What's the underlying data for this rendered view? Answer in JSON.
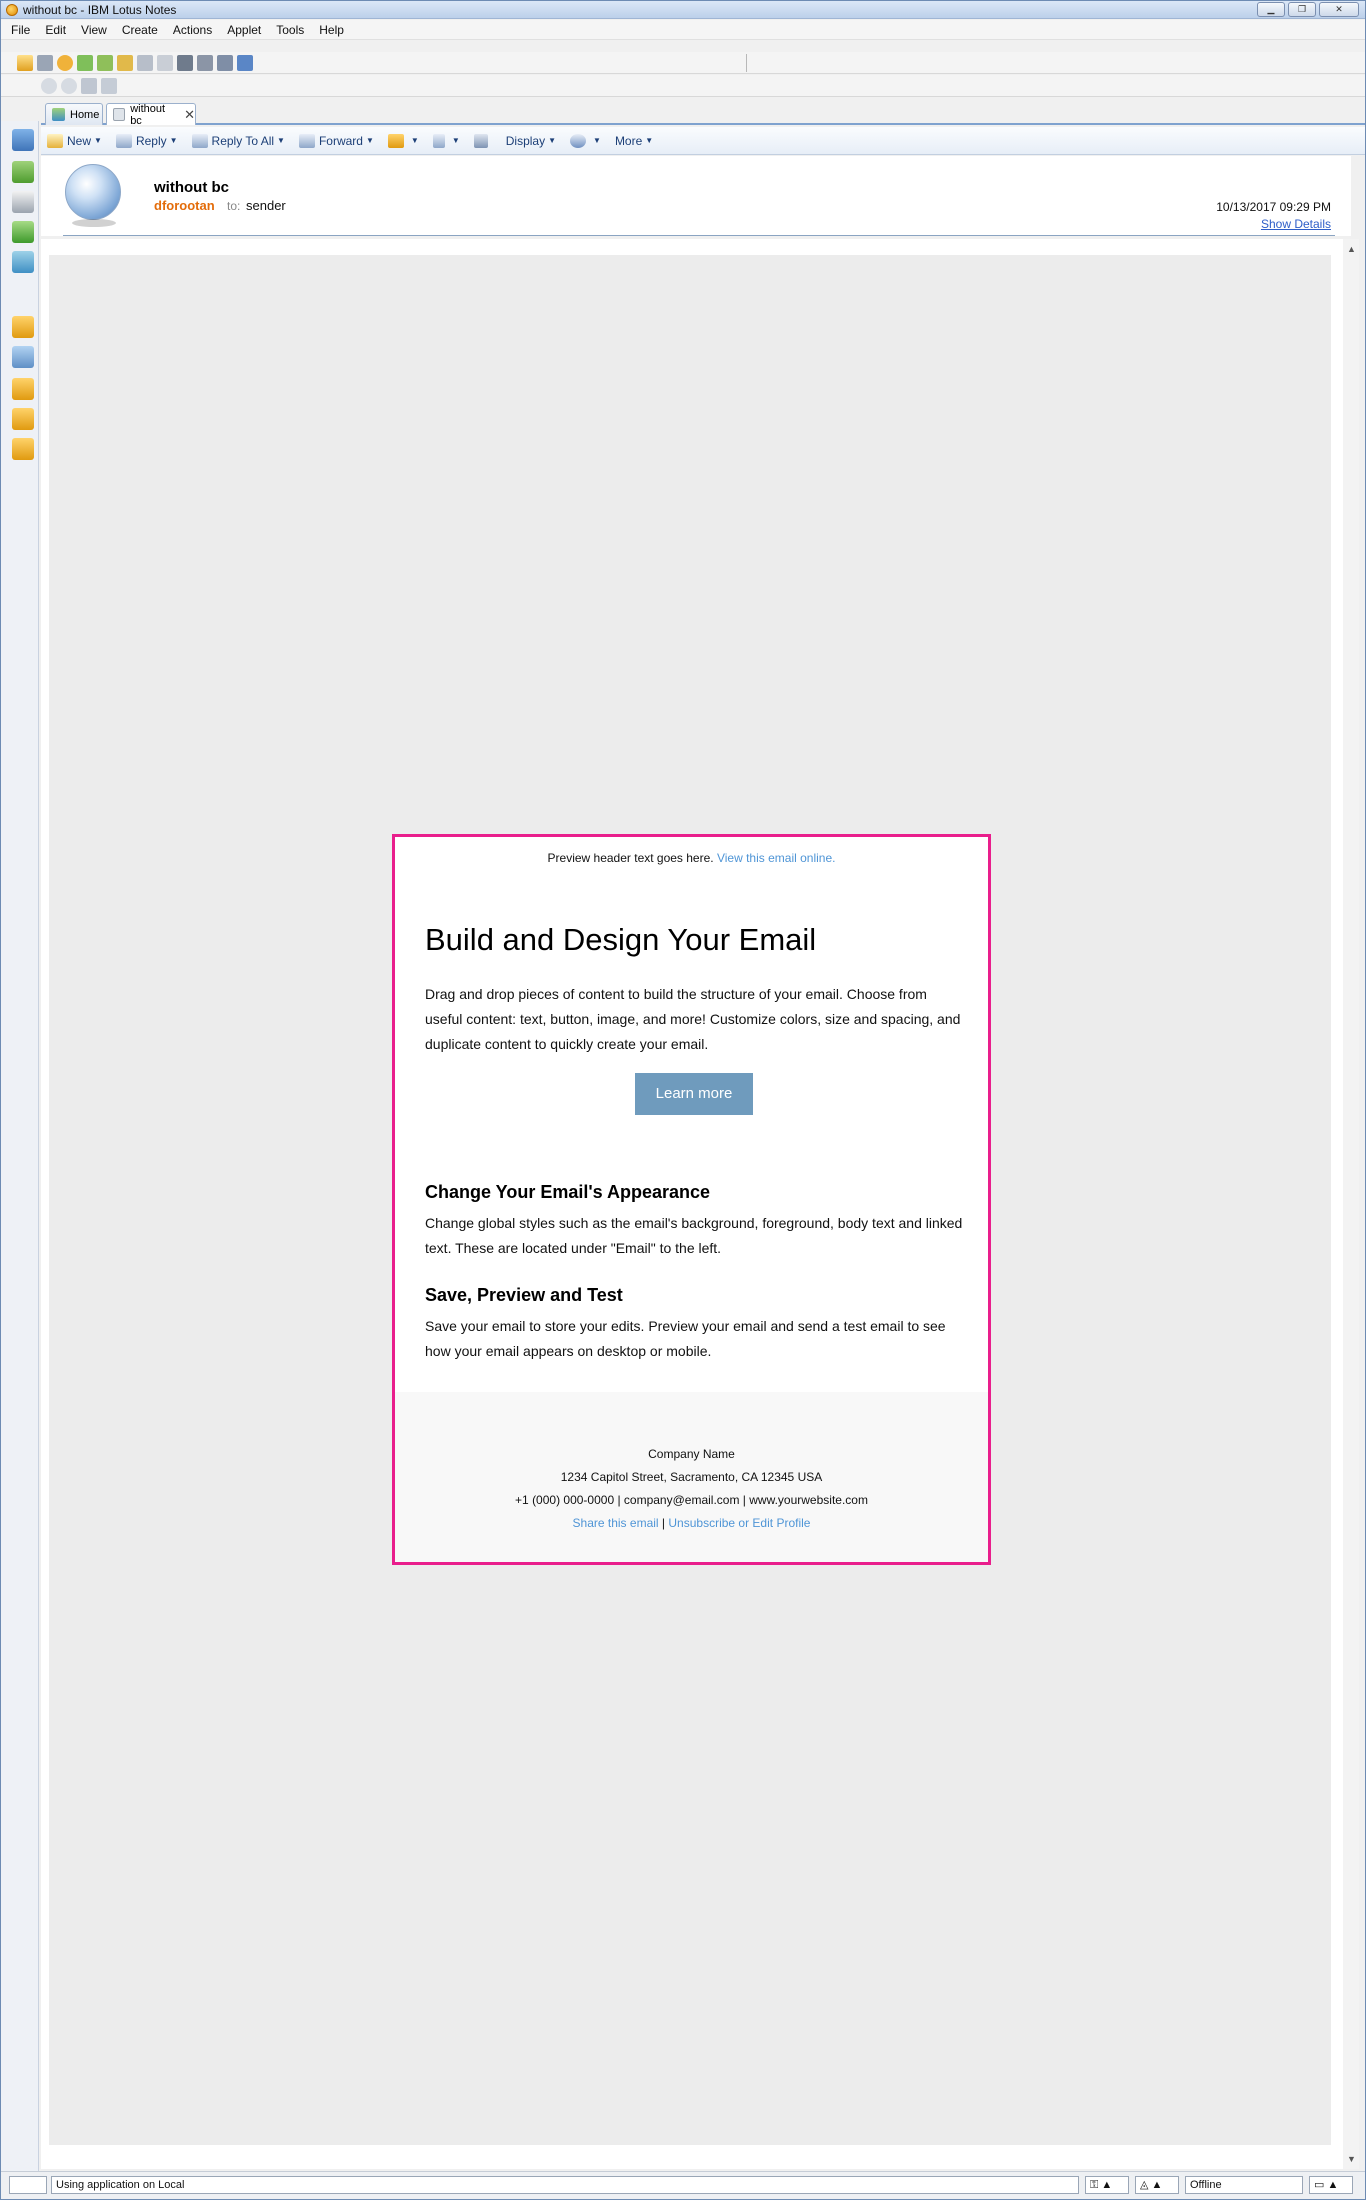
{
  "window": {
    "title": "without bc - IBM Lotus Notes"
  },
  "menu": [
    "File",
    "Edit",
    "View",
    "Create",
    "Actions",
    "Applet",
    "Tools",
    "Help"
  ],
  "tabs": [
    {
      "label": "Home"
    },
    {
      "label": "without bc"
    }
  ],
  "actions": {
    "new": "New",
    "reply": "Reply",
    "reply_all": "Reply To All",
    "forward": "Forward",
    "display": "Display",
    "more": "More"
  },
  "message": {
    "subject": "without bc",
    "from": "dforootan",
    "to_label": "to:",
    "to": "sender",
    "date": "10/13/2017 09:29 PM",
    "show_details": "Show Details"
  },
  "email": {
    "preheader_text": "Preview header text goes here.",
    "preheader_link": "View this email online.",
    "heading": "Build and Design Your Email",
    "intro": "Drag and drop pieces of content to build the structure of your email. Choose from useful content: text, button, image, and more! Customize colors, size and spacing, and duplicate content to quickly create your email.",
    "button": "Learn more",
    "section1_title": "Change Your Email's Appearance",
    "section1_body": "Change global styles such as the email's background, foreground, body text and linked text. These are located under \"Email\" to the left.",
    "section2_title": "Save, Preview and Test",
    "section2_body": "Save your email to store your edits. Preview your email and send a test email to see how your email appears on desktop or mobile.",
    "footer": {
      "company": "Company Name",
      "address": "1234 Capitol Street, Sacramento, CA 12345 USA",
      "contact": "+1 (000) 000-0000 | company@email.com | www.yourwebsite.com",
      "share": "Share this email",
      "separator": "|",
      "unsubscribe": "Unsubscribe or Edit Profile"
    }
  },
  "status": {
    "message": "Using application on Local",
    "location": "Offline"
  },
  "colors": {
    "email_border": "#e91e8c",
    "button_bg": "#6f9bbd",
    "link": "#4f95d6",
    "sender": "#e36c0a"
  }
}
